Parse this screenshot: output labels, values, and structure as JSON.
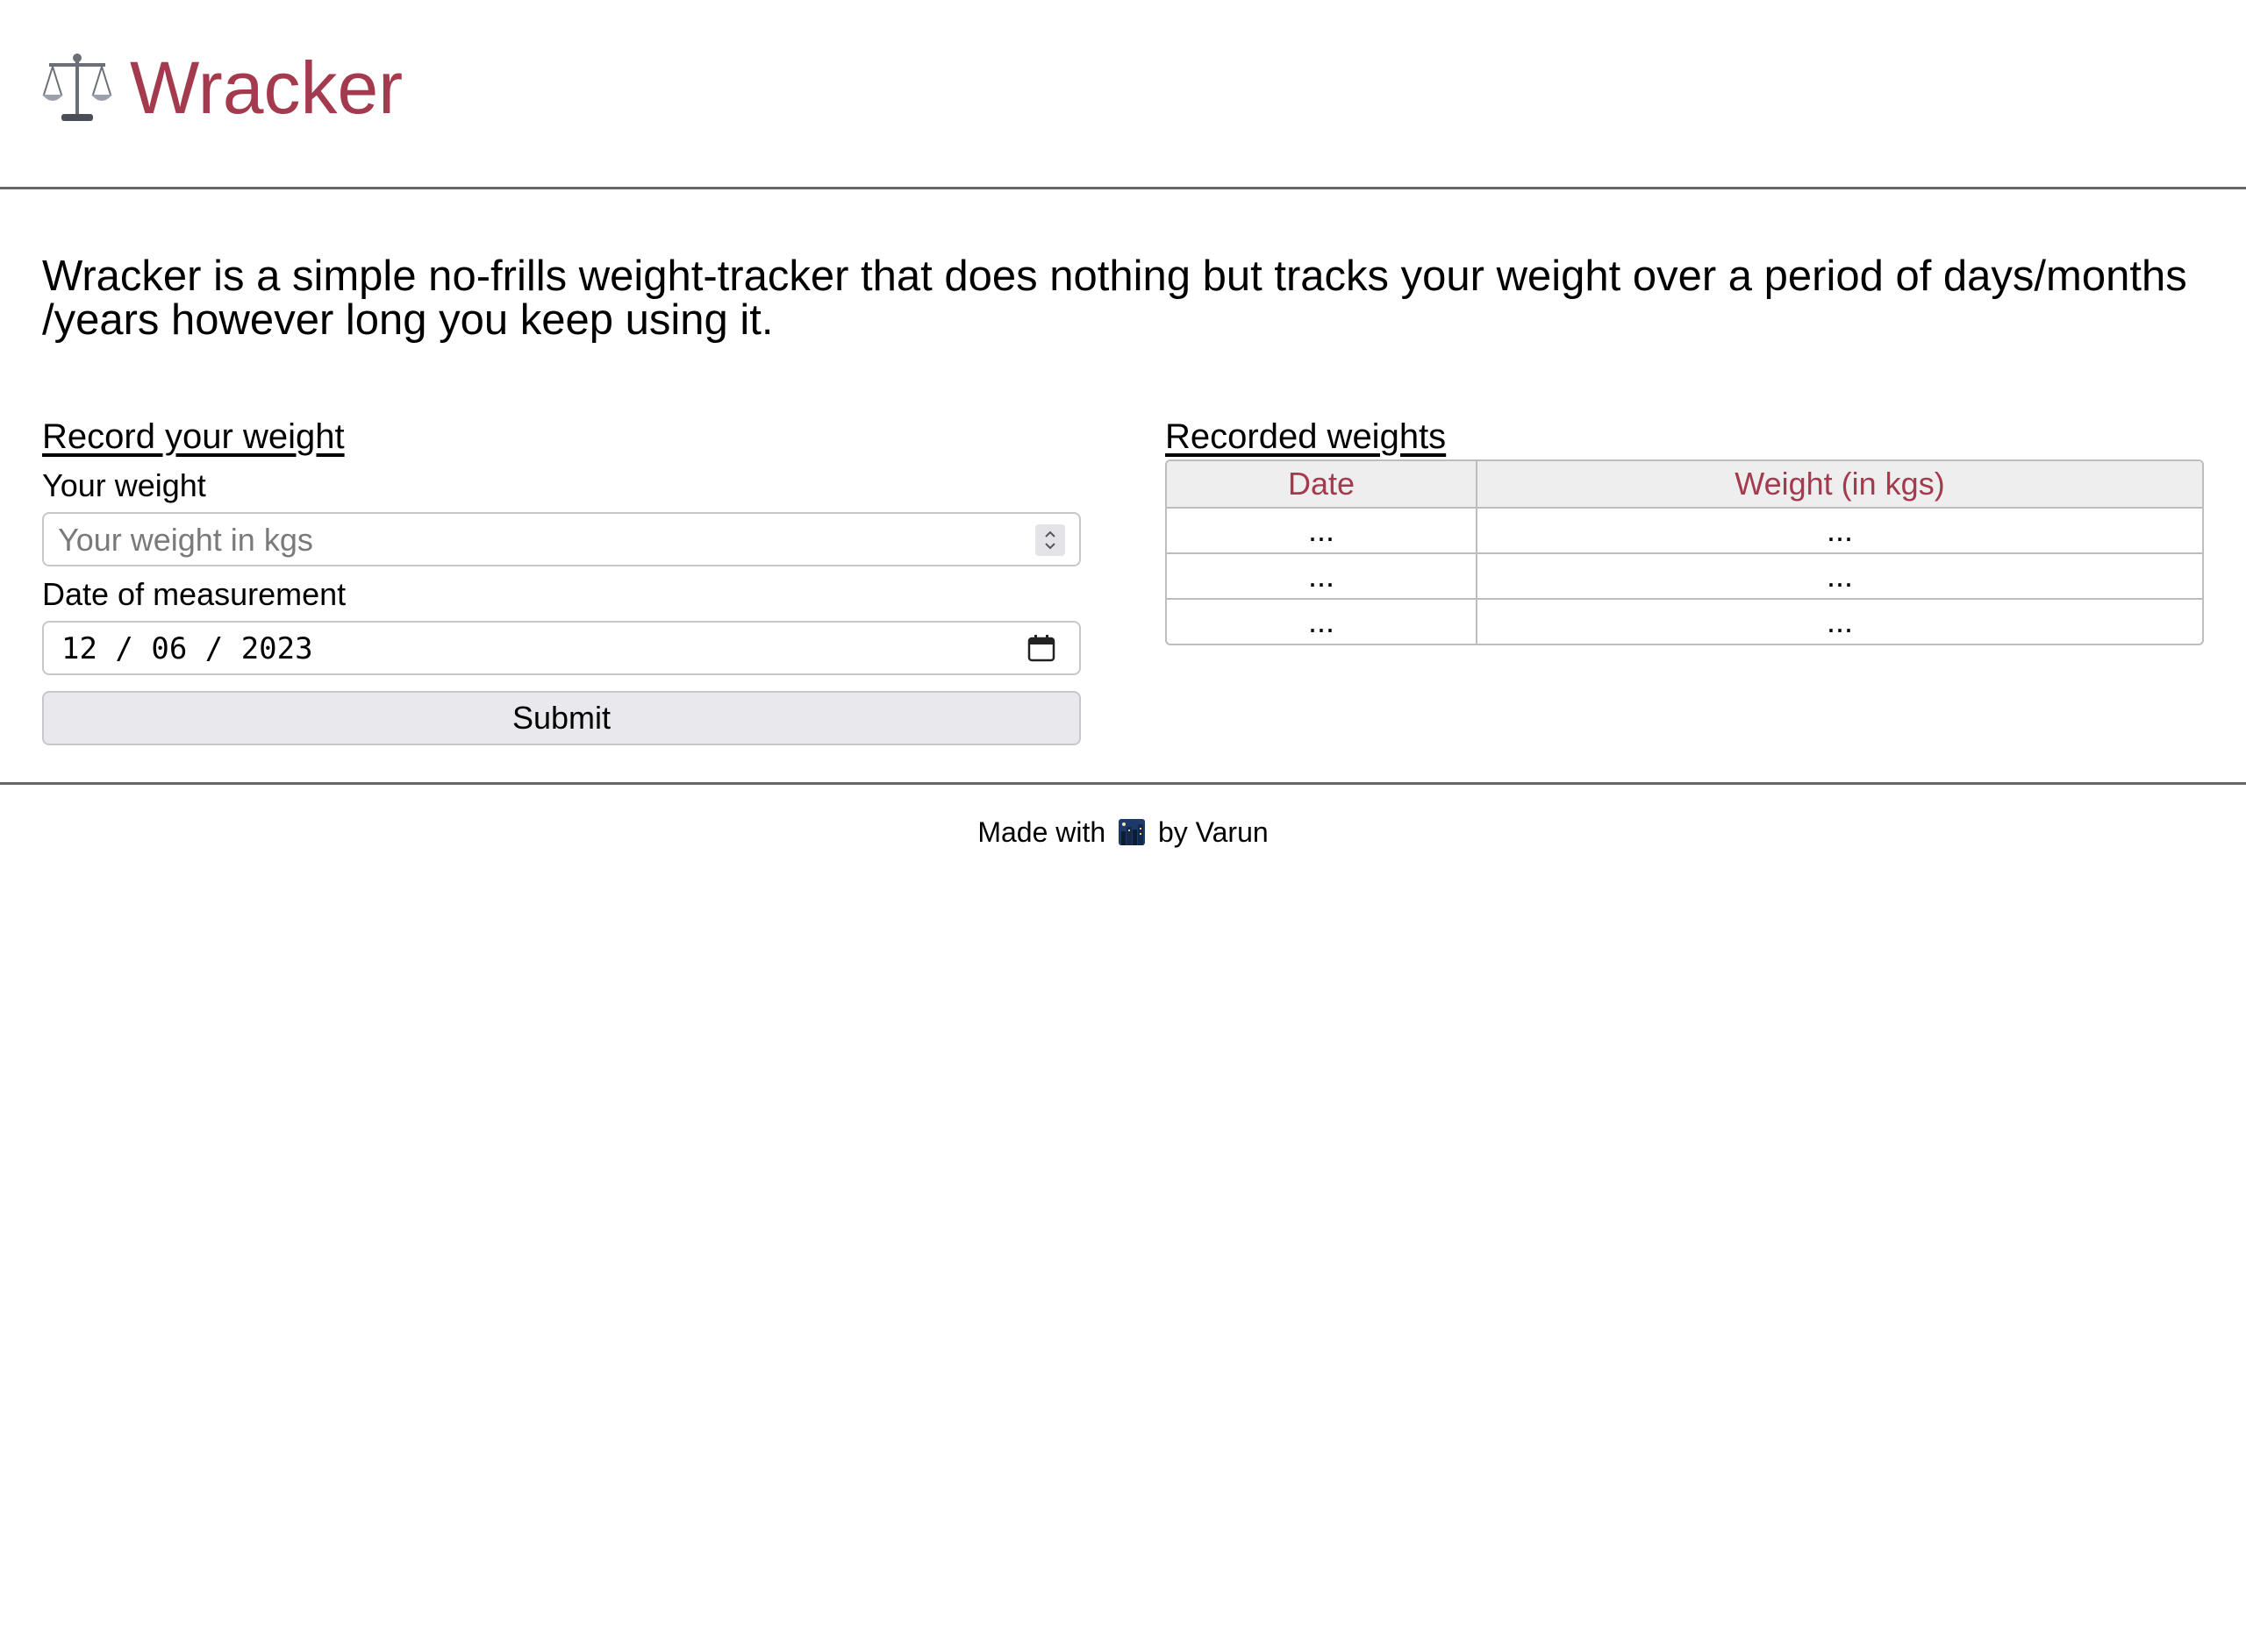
{
  "app": {
    "title": "Wracker",
    "logo_icon": "balance-scale-icon",
    "brand_color": "#A33A4E"
  },
  "intro": {
    "text": "Wracker is a simple no-frills weight-tracker that does nothing but tracks your weight over a period of days/months /years however long you keep using it."
  },
  "record_form": {
    "title": "Record your weight",
    "weight_label": "Your weight",
    "weight_placeholder": "Your weight in kgs",
    "weight_value": "",
    "date_label": "Date of measurement",
    "date_value": "12 / 06 / 2023",
    "submit_label": "Submit"
  },
  "recorded": {
    "title": "Recorded weights",
    "columns": [
      "Date",
      "Weight (in kgs)"
    ],
    "rows": [
      [
        "...",
        "..."
      ],
      [
        "...",
        "..."
      ],
      [
        "...",
        "..."
      ]
    ]
  },
  "footer": {
    "prefix": "Made with",
    "icon": "night-city-emoji-icon",
    "suffix": "by Varun"
  }
}
